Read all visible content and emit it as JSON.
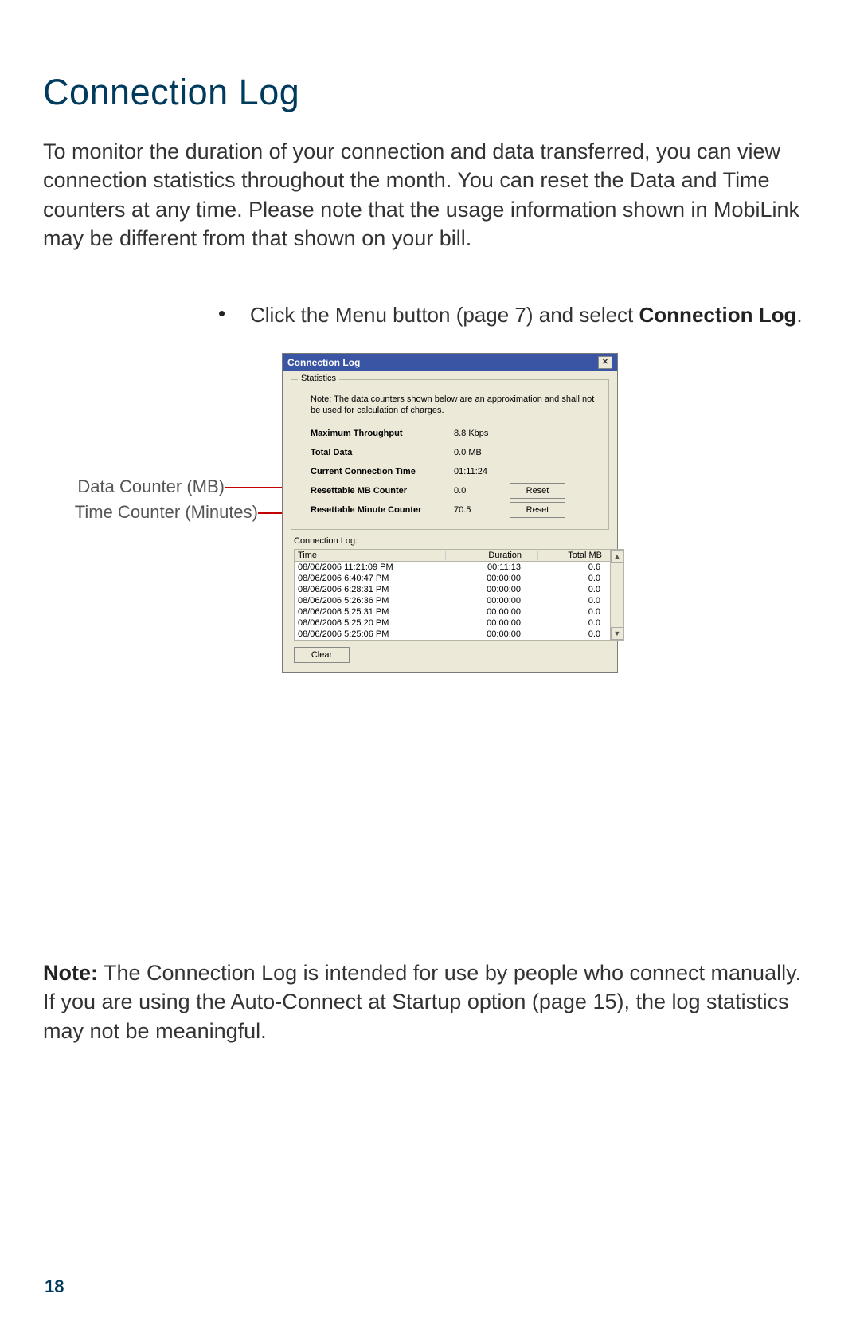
{
  "page": {
    "title": "Connection Log",
    "intro": "To monitor the duration of your connection and data transferred, you can view connection statistics throughout the month. You can reset the Data and Time counters at any time. Please note that the usage information shown in MobiLink may be different from that shown on your bill.",
    "bullet_prefix": "Click the Menu button (page 7) and select ",
    "bullet_bold": "Connection Log",
    "bullet_suffix": ".",
    "annot_mb": "Data Counter (MB)",
    "annot_min": "Time Counter (Minutes)",
    "note_label": "Note:",
    "note_body": " The Connection Log is intended for use by people who connect manually. If you are using the Auto-Connect at Startup option (page 15), the log statistics may not be meaningful.",
    "number": "18"
  },
  "dialog": {
    "title": "Connection Log",
    "group_title": "Statistics",
    "note": "Note: The data counters shown below are an approximation and shall not be used for calculation of charges.",
    "rows": {
      "throughput_label": "Maximum Throughput",
      "throughput_val": "8.8 Kbps",
      "totaldata_label": "Total Data",
      "totaldata_val": "0.0 MB",
      "conntime_label": "Current Connection Time",
      "conntime_val": "01:11:24",
      "mbcounter_label": "Resettable MB Counter",
      "mbcounter_val": "0.0",
      "mincounter_label": "Resettable Minute Counter",
      "mincounter_val": "70.5"
    },
    "reset_label": "Reset",
    "log_label": "Connection Log:",
    "headers": {
      "time": "Time",
      "duration": "Duration",
      "totalmb": "Total MB"
    },
    "log_rows": [
      {
        "time": "08/06/2006 11:21:09 PM",
        "duration": "00:11:13",
        "mb": "0.6"
      },
      {
        "time": "08/06/2006 6:40:47 PM",
        "duration": "00:00:00",
        "mb": "0.0"
      },
      {
        "time": "08/06/2006 6:28:31 PM",
        "duration": "00:00:00",
        "mb": "0.0"
      },
      {
        "time": "08/06/2006 5:26:36 PM",
        "duration": "00:00:00",
        "mb": "0.0"
      },
      {
        "time": "08/06/2006 5:25:31 PM",
        "duration": "00:00:00",
        "mb": "0.0"
      },
      {
        "time": "08/06/2006 5:25:20 PM",
        "duration": "00:00:00",
        "mb": "0.0"
      },
      {
        "time": "08/06/2006 5:25:06 PM",
        "duration": "00:00:00",
        "mb": "0.0"
      }
    ],
    "clear_label": "Clear"
  }
}
